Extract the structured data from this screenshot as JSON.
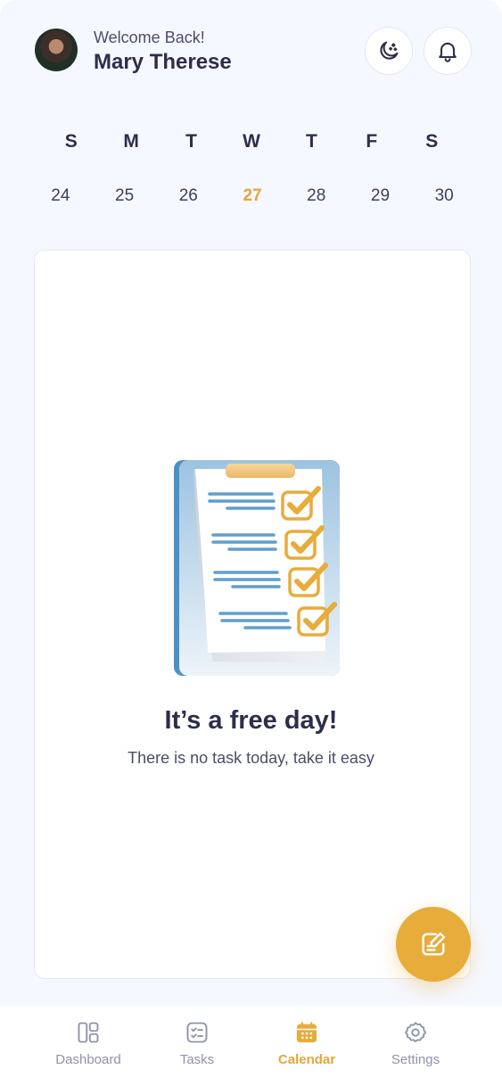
{
  "header": {
    "welcome_text": "Welcome Back!",
    "user_name": "Mary Therese",
    "avatar_icon": "user-photo",
    "theme_button_icon": "moon-stars-icon",
    "notification_button_icon": "bell-icon"
  },
  "calendar": {
    "weekdays": [
      "S",
      "M",
      "T",
      "W",
      "T",
      "F",
      "S"
    ],
    "dates": [
      "24",
      "25",
      "26",
      "27",
      "28",
      "29",
      "30"
    ],
    "selected_date": "27"
  },
  "empty_state": {
    "title": "It’s a free day!",
    "subtitle": "There is no task today, take it easy",
    "illustration": "clipboard-checklist"
  },
  "fab": {
    "icon": "edit-note-icon"
  },
  "bottom_nav": {
    "items": [
      {
        "label": "Dashboard",
        "icon": "dashboard-icon"
      },
      {
        "label": "Tasks",
        "icon": "tasks-icon"
      },
      {
        "label": "Calendar",
        "icon": "calendar-icon"
      },
      {
        "label": "Settings",
        "icon": "settings-icon"
      }
    ],
    "active": "Calendar"
  },
  "colors": {
    "accent": "#e8ac3a",
    "text_primary": "#2b2f4a",
    "text_secondary": "#8e93aa",
    "background": "#f6f8ff"
  }
}
